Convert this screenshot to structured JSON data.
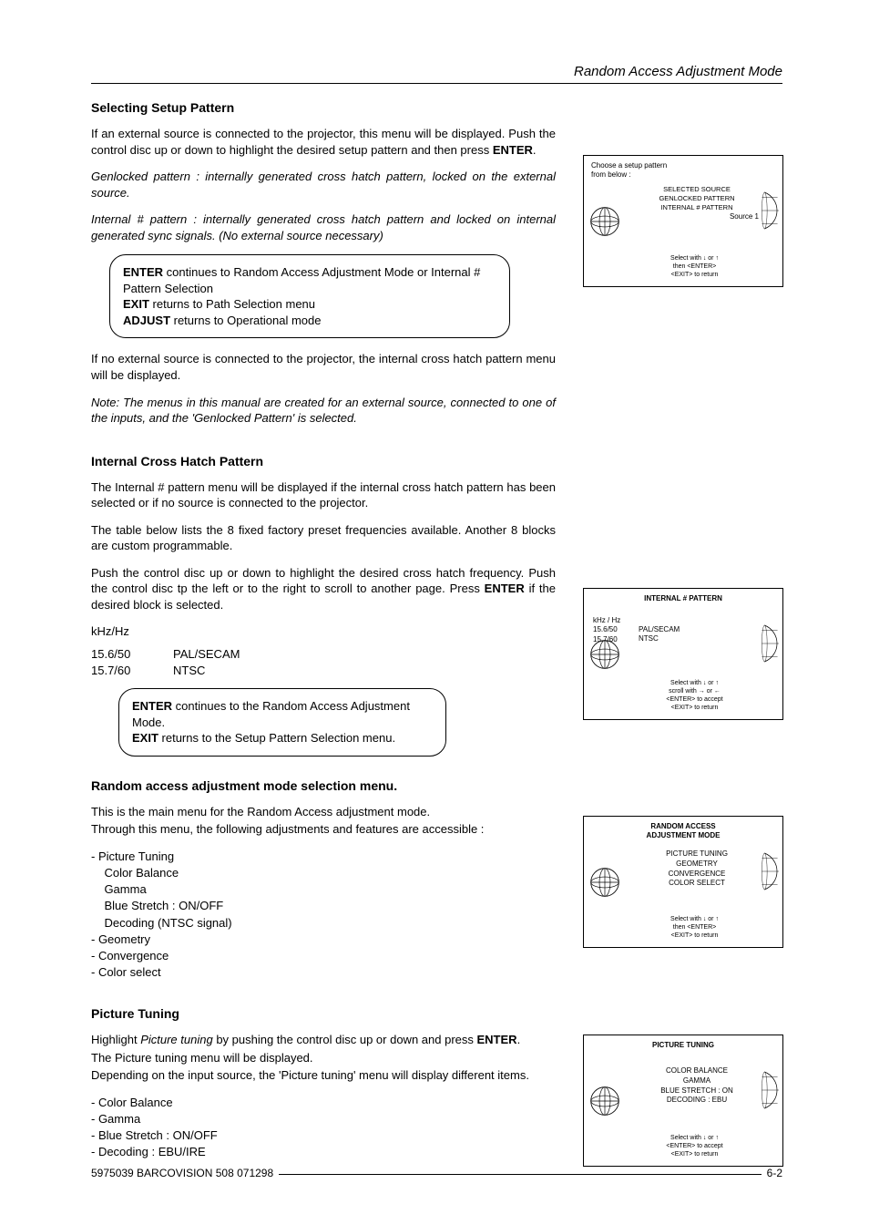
{
  "header": {
    "title": "Random Access Adjustment Mode"
  },
  "footer": {
    "doc_id": "5975039 BARCOVISION 508 071298",
    "page": "6-2"
  },
  "sec1": {
    "title": "Selecting Setup Pattern",
    "p1a": "If an external source is connected to the projector, this menu will be displayed.  Push the control disc up or down to highlight the desired setup pattern and then press ",
    "p1_enter": "ENTER",
    "p1b": ".",
    "p2": "Genlocked pattern : internally generated cross hatch pattern, locked on the external source.",
    "p3": "Internal # pattern : internally generated cross hatch pattern and locked on internal generated sync signals. (No external source necessary)",
    "box_enter": "ENTER",
    "box_enter_txt": " continues to Random Access Adjustment Mode or Internal # Pattern Selection",
    "box_exit": "EXIT",
    "box_exit_txt": " returns to Path Selection menu",
    "box_adjust": "ADJUST",
    "box_adjust_txt": " returns to Operational mode",
    "p4": "If no external source is connected to the projector, the internal cross hatch pattern menu will be displayed.",
    "p5": "Note: The menus  in this manual are created for an external source, connected to one of the inputs, and the 'Genlocked Pattern' is selected."
  },
  "sec2": {
    "title": "Internal Cross Hatch Pattern",
    "p1": "The Internal # pattern menu will be displayed if the internal cross hatch pattern has been selected or if no source is connected to the projector.",
    "p2": "The table below lists the 8 fixed  factory preset frequencies available.  Another 8 blocks are custom programmable.",
    "p3a": "Push the control disc up or down to highlight the desired cross hatch frequency.  Push the control disc tp the left or to the right to scroll to another page. Press ",
    "p3_enter": "ENTER",
    "p3b": " if the desired block is selected.",
    "tbl_hdr": "kHz/Hz",
    "r1c1": "15.6/50",
    "r1c2": "PAL/SECAM",
    "r2c1": "15.7/60",
    "r2c2": "NTSC",
    "box_enter": "ENTER",
    "box_enter_txt": " continues to the Random Access Adjustment Mode.",
    "box_exit": "EXIT",
    "box_exit_txt": " returns to the Setup Pattern Selection menu."
  },
  "sec3": {
    "title": "Random access adjustment mode selection menu.",
    "p1": "This is the main menu for the Random Access adjustment mode.",
    "p2": "Through this menu, the following adjustments and features are accessible :",
    "b1": "- Picture Tuning",
    "b1a": "    Color Balance",
    "b1b": "    Gamma",
    "b1c": "    Blue Stretch : ON/OFF",
    "b1d": "    Decoding (NTSC signal)",
    "b2": "- Geometry",
    "b3": "- Convergence",
    "b4": "- Color select"
  },
  "sec4": {
    "title": "Picture Tuning",
    "p1a": "Highlight ",
    "p1_it": "Picture tuning",
    "p1b": " by pushing the control disc up or down and press ",
    "p1_enter": "ENTER",
    "p1c": ".",
    "p2": "The Picture tuning menu will be displayed.",
    "p3": "Depending on the input source, the 'Picture tuning' menu will display different items.",
    "b1": "- Color Balance",
    "b2": "- Gamma",
    "b3": "- Blue Stretch : ON/OFF",
    "b4": "- Decoding : EBU/IRE"
  },
  "menu1": {
    "top1": "Choose a setup pattern",
    "top2": "from below :",
    "i1": "SELECTED SOURCE",
    "i2": "GENLOCKED PATTERN",
    "i3": "INTERNAL # PATTERN",
    "source": "Source 1",
    "f1": "Select with  ↓  or ↑",
    "f2": "then <ENTER>",
    "f3": "<EXIT> to return"
  },
  "menu2": {
    "title": "INTERNAL # PATTERN",
    "khz_hdr": "kHz / Hz",
    "k1": "15.6/50",
    "k2": "15.7/60",
    "n1": "PAL/SECAM",
    "n2": "NTSC",
    "f1": "Select with  ↓  or ↑",
    "f2": "scroll with → or ←",
    "f3": "<ENTER> to accept",
    "f4": "<EXIT> to return"
  },
  "menu3": {
    "title": "RANDOM  ACCESS",
    "title2": "ADJUSTMENT MODE",
    "i1": "PICTURE TUNING",
    "i2": "GEOMETRY",
    "i3": "CONVERGENCE",
    "i4": "COLOR SELECT",
    "f1": "Select with  ↓  or ↑",
    "f2": "then <ENTER>",
    "f3": "<EXIT> to return"
  },
  "menu4": {
    "title": "PICTURE TUNING",
    "i1": "COLOR BALANCE",
    "i2": "GAMMA",
    "i3": "BLUE STRETCH  :  ON",
    "i4": "DECODING  :  EBU",
    "f1": "Select with  ↓  or ↑",
    "f2": "<ENTER> to accept",
    "f3": "<EXIT> to return"
  }
}
